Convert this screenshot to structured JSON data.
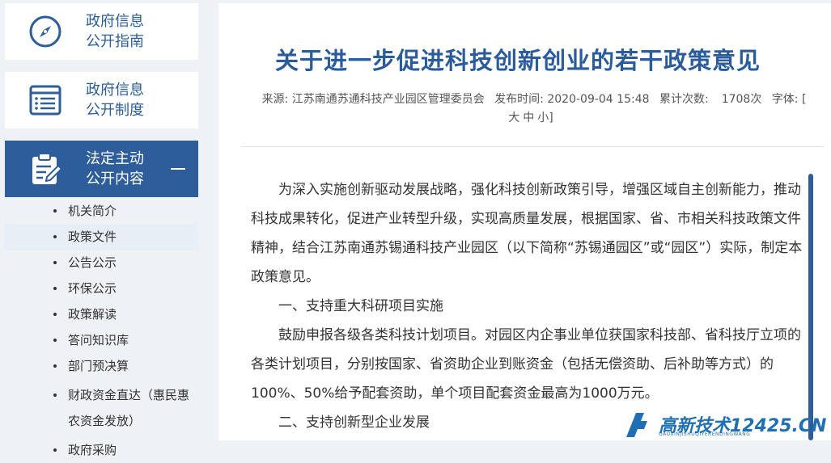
{
  "sidebar": {
    "cards": [
      {
        "line1": "政府信息",
        "line2": "公开指南",
        "icon": "compass-icon"
      },
      {
        "line1": "政府信息",
        "line2": "公开制度",
        "icon": "list-document-icon"
      },
      {
        "line1": "法定主动",
        "line2": "公开内容",
        "icon": "clipboard-edit-icon",
        "toggle": "collapse-icon"
      }
    ],
    "items": [
      {
        "label": "机关简介"
      },
      {
        "label": "政策文件"
      },
      {
        "label": "公告公示"
      },
      {
        "label": "环保公示"
      },
      {
        "label": "政策解读"
      },
      {
        "label": "答问知识库"
      },
      {
        "label": "部门预决算"
      },
      {
        "label": "财政资金直达（惠民惠农资金发放）"
      },
      {
        "label": "政府采购"
      }
    ]
  },
  "article": {
    "title": "关于进一步促进科技创新创业的若干政策意见",
    "meta": {
      "source": "来源: 江苏南通苏通科技产业园区管理委员会",
      "publish": "发布时间:  2020-09-04 15:48",
      "views_label": "累计次数:",
      "views": "1708次",
      "font_label": "字体: [",
      "font_large": "大",
      "font_medium": "中",
      "font_small": "小",
      "font_close": "]"
    },
    "paragraphs": [
      "为深入实施创新驱动发展战略，强化科技创新政策引导，增强区域自主创新能力，推动科技成果转化，促进产业转型升级，实现高质量发展，根据国家、省、市相关科技政策文件精神，结合江苏南通苏锡通科技产业园区（以下简称“苏锡通园区”或“园区”）实际，制定本政策意见。",
      "一、支持重大科研项目实施",
      "鼓励申报各级各类科技计划项目。对园区内企事业单位获国家科技部、省科技厅立项的各类计划项目，分别按国家、省资助企业到账资金（包括无偿资助、后补助等方式）的100%、50%给予配套资助，单个项目配套资金最高为1000万元。",
      "二、支持创新型企业发展"
    ]
  },
  "watermark": {
    "text": "高新技术12425.CN",
    "sub": "GAOXINJISHUQIYERENDINGWANG"
  },
  "colors": {
    "accent": "#2d5d9a",
    "title": "#2a5b9c",
    "background": "#eef1f5"
  }
}
